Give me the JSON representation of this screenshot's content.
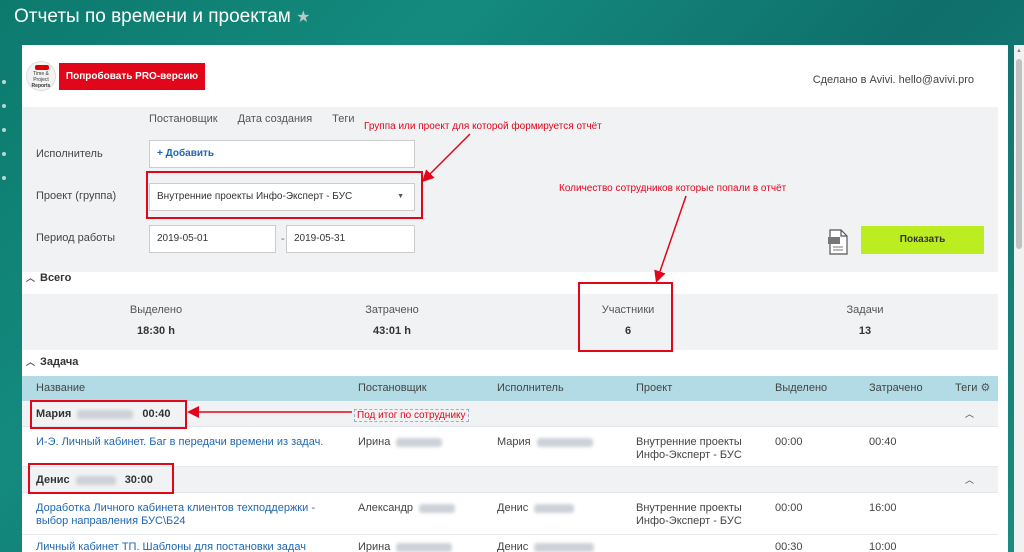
{
  "header": {
    "title": "Отчеты по времени и проектам",
    "star": "★"
  },
  "top": {
    "logo_lines": [
      "Time & Project",
      "Reports"
    ],
    "pro_button": "Попробовать PRO-версию",
    "made_by": "Сделано в Avivi. hello@avivi.pro"
  },
  "filters": {
    "tabs": [
      "Постановщик",
      "Дата создания",
      "Теги"
    ],
    "executor_label": "Исполнитель",
    "add_label": "+ Добавить",
    "project_label": "Проект (группа)",
    "project_value": "Внутренние проекты Инфо-Эксперт - БУС",
    "period_label": "Период работы",
    "date_from": "2019-05-01",
    "date_to": "2019-05-31",
    "range_sep": "-",
    "show_button": "Показать"
  },
  "totals": {
    "section": "Всего",
    "allocated_label": "Выделено",
    "allocated_value": "18:30 h",
    "spent_label": "Затрачено",
    "spent_value": "43:01 h",
    "participants_label": "Участники",
    "participants_value": "6",
    "tasks_label": "Задачи",
    "tasks_value": "13"
  },
  "tasks": {
    "section": "Задача",
    "columns": [
      "Название",
      "Постановщик",
      "Исполнитель",
      "Проект",
      "Выделено",
      "Затрачено",
      "Теги"
    ],
    "groups": [
      {
        "name": "Мария",
        "time": "00:40",
        "rows": [
          {
            "title": "И-Э. Личный кабинет. Баг в передачи времени из задач.",
            "author": "Ирина",
            "executor": "Мария",
            "project": "Внутренние проекты Инфо-Эксперт - БУС",
            "allocated": "00:00",
            "spent": "00:40"
          }
        ]
      },
      {
        "name": "Денис",
        "time": "30:00",
        "rows": [
          {
            "title": "Доработка Личного кабинета клиентов техподдержки - выбор направления БУС\\Б24",
            "author": "Александр",
            "executor": "Денис",
            "project": "Внутренние проекты Инфо-Эксперт - БУС",
            "allocated": "00:00",
            "spent": "16:00"
          },
          {
            "title": "Личный кабинет ТП. Шаблоны для постановки задач",
            "author": "Ирина",
            "executor": "Денис",
            "project": "",
            "allocated": "00:30",
            "spent": "10:00"
          }
        ]
      }
    ]
  },
  "annotations": {
    "group_note": "Группа или проект для которой формируется отчёт",
    "count_note": "Количество сотрудников которые попали в отчёт",
    "subtotal_note": "Под итог по сотруднику"
  },
  "colors": {
    "accent_red": "#e2061b",
    "show_green": "#bbed21",
    "link_blue": "#2067b0",
    "table_head": "#b3dbe6"
  }
}
